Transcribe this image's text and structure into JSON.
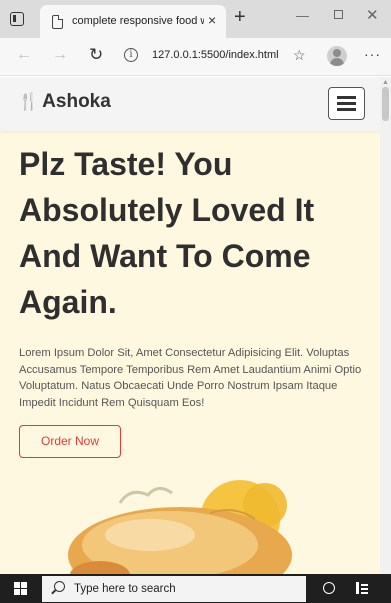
{
  "browser": {
    "tab_title": "complete responsive food websi",
    "tab_close": "×",
    "new_tab": "+",
    "url": "127.0.0.1:5500/index.html",
    "icons": {
      "tab_actions": "tab-actions-icon",
      "page": "page-icon",
      "back": "back-arrow-icon",
      "forward": "forward-arrow-icon",
      "reload": "reload-icon",
      "info": "info-icon",
      "favorite": "favorite-icon",
      "profile": "profile-avatar",
      "more": "more-icon"
    }
  },
  "site": {
    "logo_text": "Ashoka",
    "logo_icon": "utensils-icon",
    "menu_icon": "hamburger-icon",
    "hero_title": "Plz Taste! You Absolutely Loved It And Want To Come Again.",
    "hero_text": "Lorem Ipsum Dolor Sit, Amet Consectetur Adipisicing Elit. Voluptas Accusamus Tempore Temporibus Rem Amet Laudantium Animi Optio Voluptatum. Natus Obcaecati Unde Porro Nostrum Ipsam Itaque Impedit Incidunt Rem Quisquam Eos!",
    "order_button": "Order Now"
  },
  "taskbar": {
    "search_placeholder": "Type here to search",
    "icons": {
      "start": "windows-start-icon",
      "search": "search-icon",
      "cortana": "cortana-icon",
      "task_view": "task-view-icon"
    }
  },
  "colors": {
    "accent": "#e53935",
    "hero_bg": "#fff8e1",
    "header_bg": "#f4f4f4",
    "taskbar_bg": "#1f1f1f"
  }
}
